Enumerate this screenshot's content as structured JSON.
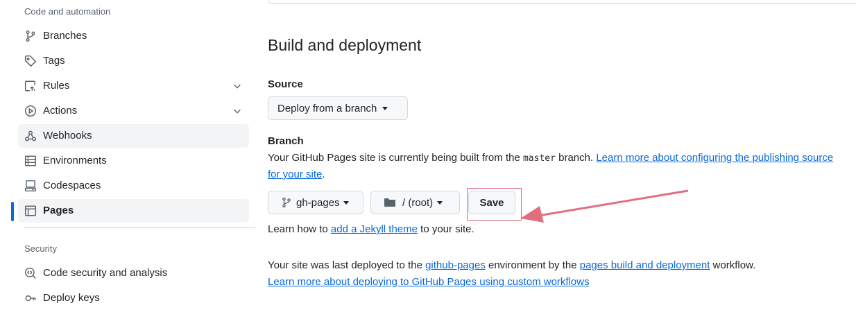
{
  "sidebar": {
    "sections": [
      {
        "title": "Code and automation"
      },
      {
        "title": "Security"
      }
    ],
    "items": [
      {
        "label": "Branches",
        "icon": "git-branch-icon"
      },
      {
        "label": "Tags",
        "icon": "tag-icon"
      },
      {
        "label": "Rules",
        "icon": "rules-icon"
      },
      {
        "label": "Actions",
        "icon": "play-circle-icon"
      },
      {
        "label": "Webhooks",
        "icon": "webhook-icon"
      },
      {
        "label": "Environments",
        "icon": "server-icon"
      },
      {
        "label": "Codespaces",
        "icon": "codespaces-icon"
      },
      {
        "label": "Pages",
        "icon": "browser-icon"
      },
      {
        "label": "Code security and analysis",
        "icon": "codescan-icon"
      },
      {
        "label": "Deploy keys",
        "icon": "key-icon"
      }
    ],
    "active_item": "Pages"
  },
  "main": {
    "heading": "Build and deployment",
    "source": {
      "label": "Source",
      "dropdown_value": "Deploy from a branch"
    },
    "branch": {
      "label": "Branch",
      "desc_before": "Your GitHub Pages site is currently being built from the ",
      "desc_branch": "master",
      "desc_after": " branch. ",
      "desc_link1": "Learn more about configuring the publishing source",
      "desc_link2": "for your site",
      "desc_end": ".",
      "branch_select": "gh-pages",
      "folder_select": "/ (root)",
      "save_label": "Save"
    },
    "theme": {
      "before": "Learn how to ",
      "link": "add a Jekyll theme",
      "after": " to your site."
    },
    "deploy": {
      "line1_before": "Your site was last deployed to the ",
      "line1_env": "github-pages",
      "line1_mid": " environment by the ",
      "line1_workflow": "pages build and deployment",
      "line1_after": " workflow.",
      "line2_link": "Learn more about deploying to GitHub Pages using custom workflows"
    }
  },
  "colors": {
    "accent": "#0969da",
    "annotation": "#e07080"
  }
}
